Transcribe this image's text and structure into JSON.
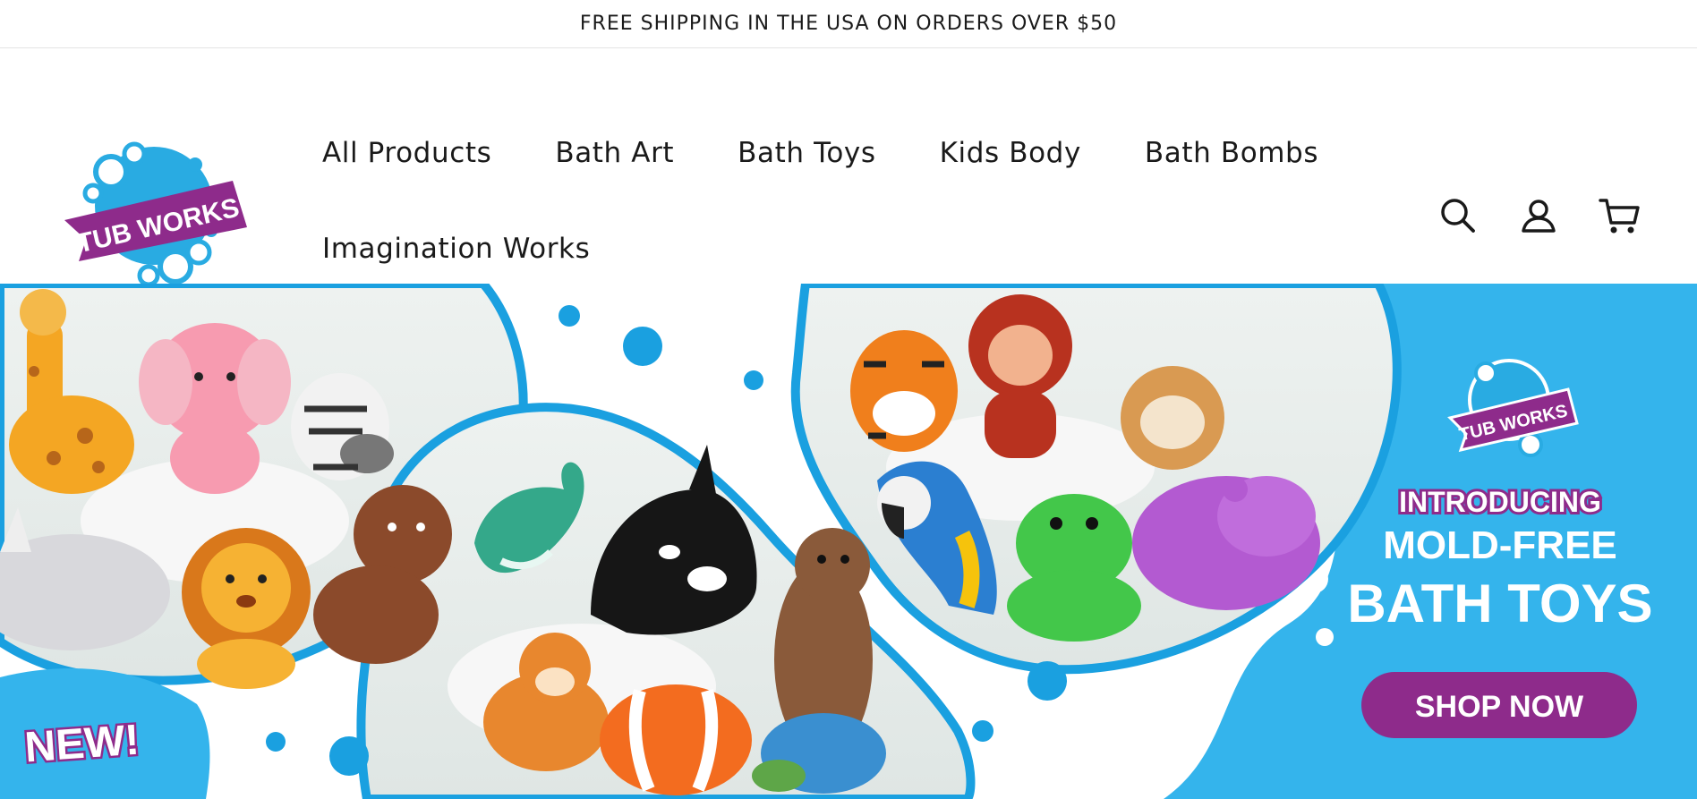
{
  "announcement": {
    "text": "FREE SHIPPING IN THE USA ON ORDERS OVER $50"
  },
  "brand": {
    "logo_text": "TUB WORKS"
  },
  "nav": {
    "items": [
      {
        "label": "All Products"
      },
      {
        "label": "Bath Art"
      },
      {
        "label": "Bath Toys"
      },
      {
        "label": "Kids Body"
      },
      {
        "label": "Bath Bombs"
      },
      {
        "label": "Imagination Works"
      }
    ]
  },
  "header_icons": {
    "search": "search-icon",
    "account": "user-icon",
    "cart": "cart-icon"
  },
  "hero": {
    "badge": "NEW!",
    "logo_text": "TUB WORKS",
    "headline_1": "INTRODUCING",
    "headline_2": "MOLD-FREE",
    "headline_3": "BATH TOYS",
    "cta": "SHOP NOW"
  },
  "colors": {
    "brand_blue": "#29abe2",
    "brand_purple": "#8e2b8b",
    "hero_blue": "#34b4ec"
  }
}
